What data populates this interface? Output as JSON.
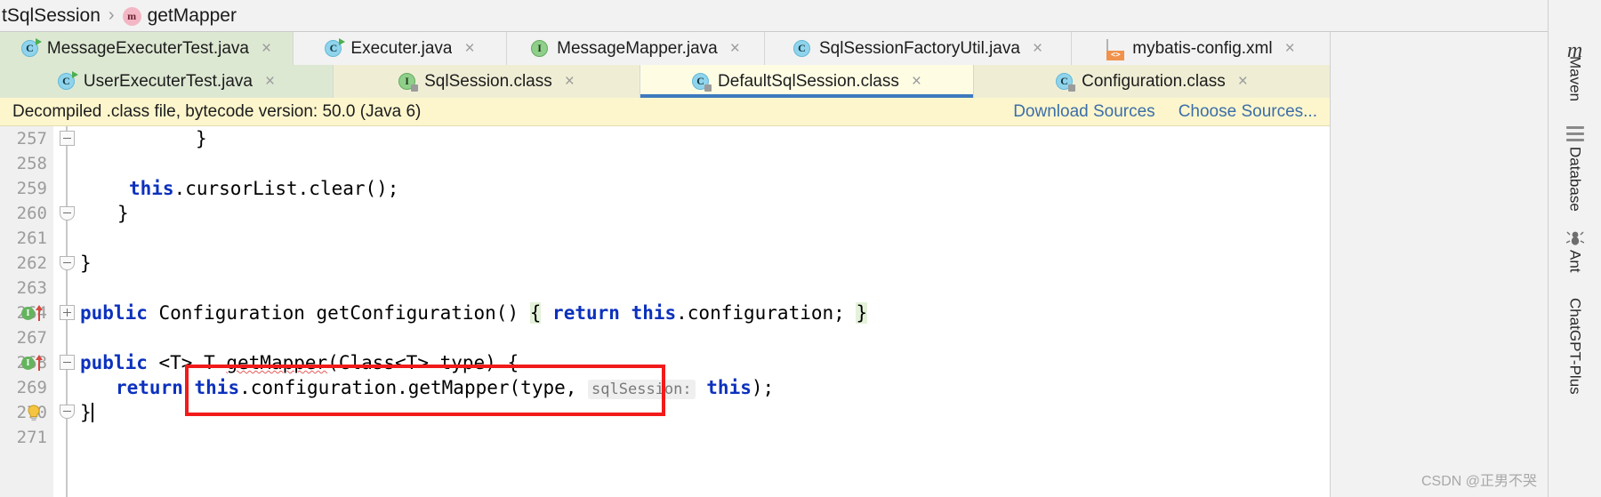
{
  "breadcrumb": {
    "root_label": "tSqlSession",
    "separator": "›",
    "method_icon": "method-icon",
    "method_icon_letter": "m",
    "method_label": "getMapper"
  },
  "tabs": {
    "close_glyph": "×",
    "row1": [
      {
        "label": "MessageExecuterTest.java",
        "icon": "java-class-icon",
        "icon_letter": "C",
        "icon_kind": "class",
        "runnable": true,
        "state": "modified-green",
        "closable": true
      },
      {
        "label": "Executer.java",
        "icon": "java-class-icon",
        "icon_letter": "C",
        "icon_kind": "class",
        "runnable": true,
        "state": "normal",
        "closable": true
      },
      {
        "label": "MessageMapper.java",
        "icon": "java-interface-icon",
        "icon_letter": "I",
        "icon_kind": "interface",
        "runnable": false,
        "state": "normal",
        "closable": true
      },
      {
        "label": "SqlSessionFactoryUtil.java",
        "icon": "java-class-icon",
        "icon_letter": "C",
        "icon_kind": "class",
        "runnable": false,
        "state": "normal",
        "closable": true
      },
      {
        "label": "mybatis-config.xml",
        "icon": "xml-file-icon",
        "icon_letter": "",
        "icon_kind": "xml",
        "runnable": false,
        "state": "normal",
        "closable": true
      }
    ],
    "row2": [
      {
        "label": "UserExecuterTest.java",
        "icon": "java-class-icon",
        "icon_letter": "C",
        "icon_kind": "class",
        "runnable": true,
        "state": "modified-green",
        "closable": true
      },
      {
        "label": "SqlSession.class",
        "icon": "java-interface-icon",
        "icon_letter": "I",
        "icon_kind": "interface-locked",
        "runnable": false,
        "state": "decompiled",
        "closable": true
      },
      {
        "label": "DefaultSqlSession.class",
        "icon": "java-class-icon",
        "icon_letter": "C",
        "icon_kind": "class-locked",
        "runnable": false,
        "state": "active",
        "closable": true
      },
      {
        "label": "Configuration.class",
        "icon": "java-class-icon",
        "icon_letter": "C",
        "icon_kind": "class-locked",
        "runnable": false,
        "state": "decompiled",
        "closable": true
      }
    ]
  },
  "notification": {
    "message": "Decompiled .class file, bytecode version: 50.0 (Java 6)",
    "links": [
      "Download Sources",
      "Choose Sources..."
    ],
    "background": "#fdf6cd",
    "link_color": "#3b6ea8"
  },
  "editor": {
    "lines": [
      {
        "num": "257",
        "indent": 13,
        "text": "}"
      },
      {
        "num": "258",
        "indent": 0,
        "text": ""
      },
      {
        "num": "259",
        "indent": 8,
        "text": "this.cursorList.clear();"
      },
      {
        "num": "260",
        "indent": 6,
        "text": "}"
      },
      {
        "num": "261",
        "indent": 0,
        "text": ""
      },
      {
        "num": "262",
        "indent": 4,
        "text": "}"
      },
      {
        "num": "263",
        "indent": 0,
        "text": ""
      },
      {
        "num": "264",
        "indent": 4,
        "text": "public Configuration getConfiguration() { return this.configuration; }"
      },
      {
        "num": "267",
        "indent": 0,
        "text": ""
      },
      {
        "num": "268",
        "indent": 4,
        "text": "public <T> T getMapper(Class<T> type) {"
      },
      {
        "num": "269",
        "indent": 6,
        "text": "return this.configuration.getMapper(type, sqlSession: this);"
      },
      {
        "num": "270",
        "indent": 4,
        "text": "}"
      },
      {
        "num": "271",
        "indent": 0,
        "text": ""
      }
    ],
    "inlay_hint": "sqlSession:",
    "gutter_icons": {
      "implements_letter": "I",
      "implements_line_a": "264",
      "implements_line_b": "268",
      "intention_bulb_line": "270"
    },
    "annotation": {
      "shape": "rectangle",
      "color": "#f21a1a",
      "highlights_line": "269"
    }
  },
  "right_sidebar": {
    "logo": "m",
    "items": [
      {
        "label": "Maven",
        "icon": "maven-icon"
      },
      {
        "label": "Database",
        "icon": "database-icon"
      },
      {
        "label": "Ant",
        "icon": "ant-icon"
      },
      {
        "label": "ChatGPT-Plus",
        "icon": "chatgpt-icon"
      }
    ]
  },
  "watermark": {
    "text": "CSDN @正男不哭"
  }
}
